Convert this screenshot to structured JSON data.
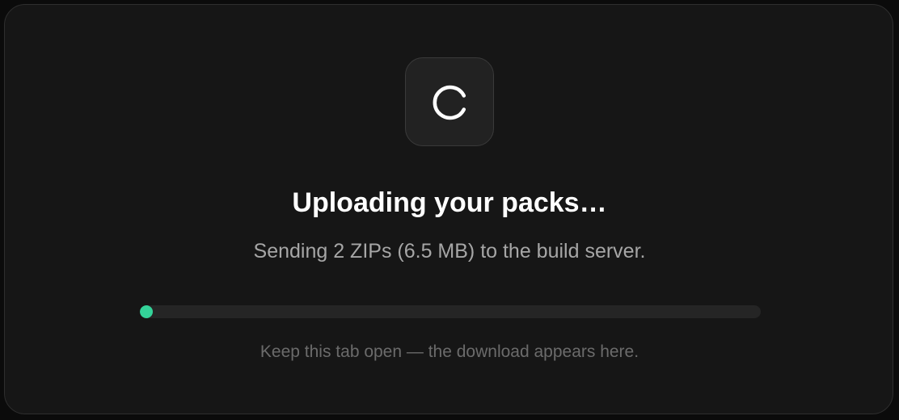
{
  "dialog": {
    "icon": "loading-spinner-icon",
    "title": "Uploading your packs…",
    "subtitle": "Sending 2 ZIPs (6.5 MB) to the build server.",
    "progress_fraction": 0.01,
    "hint": "Keep this tab open — the download appears here."
  },
  "colors": {
    "background": "#161616",
    "accent": "#34d399",
    "title": "#ffffff",
    "subtitle": "#a6a6a6",
    "hint": "#6b6b6b"
  }
}
